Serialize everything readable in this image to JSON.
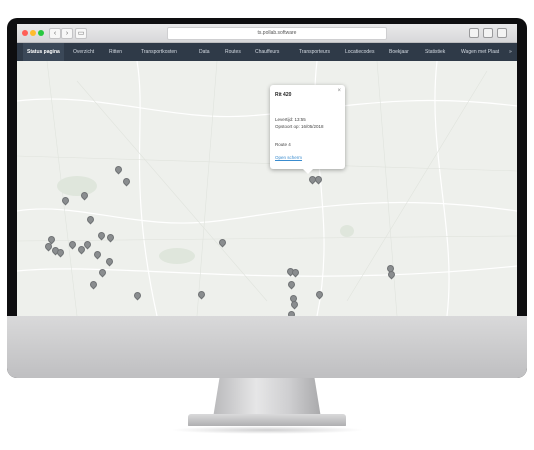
{
  "browser": {
    "url": "ts.pollab.software"
  },
  "nav": {
    "tabs": [
      "Status pagina",
      "Overzicht",
      "Ritten",
      "Transportkosten",
      "Data",
      "Routes",
      "Chauffeurs",
      "Transporteurs",
      "Locatiecodes",
      "Boekjaar",
      "Statistiek",
      "Wagen met Plaat"
    ],
    "more": "»"
  },
  "popup": {
    "title": "Rit 420",
    "line1": "Levertijd: 13:55",
    "line2": "Opstoort op: 16/05/2018",
    "line3": "Route 4",
    "link": "Open scherm",
    "close": "×"
  },
  "colors": {
    "nav_bg": "#2f3a48",
    "map_bg": "#eef0ec",
    "pin": "#8a8d8f",
    "link": "#3a8ccf"
  }
}
